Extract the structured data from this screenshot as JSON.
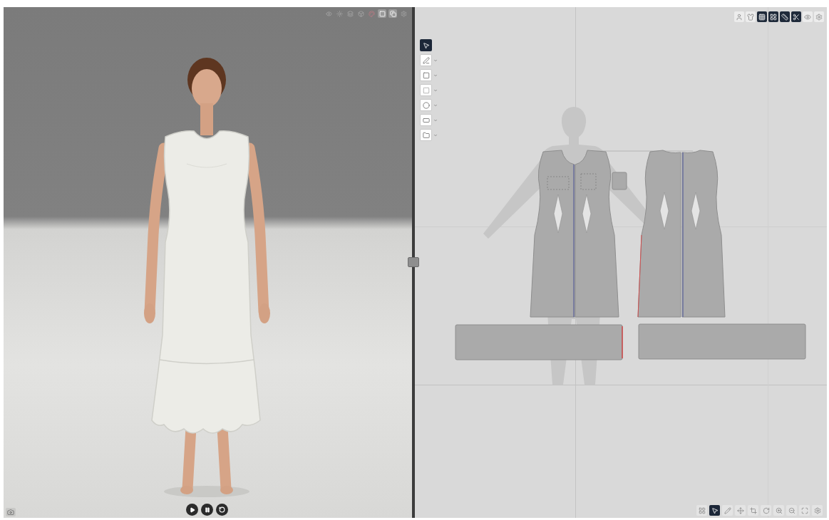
{
  "viewport_3d": {
    "toolbar": [
      {
        "on": false
      },
      {
        "on": false
      },
      {
        "on": false
      },
      {
        "on": false
      },
      {
        "on": false
      },
      {
        "on": true
      },
      {
        "on": true
      },
      {
        "on": false
      }
    ]
  },
  "pattern_view": {
    "toolbar": [
      {
        "selected": false
      },
      {
        "selected": false
      },
      {
        "selected": true
      },
      {
        "selected": true
      },
      {
        "selected": true
      },
      {
        "selected": true
      },
      {
        "selected": false
      },
      {
        "selected": false
      }
    ],
    "tools": [
      {
        "selected": true,
        "has_menu": false
      },
      {
        "selected": false,
        "has_menu": true
      },
      {
        "selected": false,
        "has_menu": true
      },
      {
        "selected": false,
        "has_menu": true
      },
      {
        "selected": false,
        "has_menu": true
      },
      {
        "selected": false,
        "has_menu": true
      },
      {
        "selected": false,
        "has_menu": true
      }
    ],
    "bottom_toolbar": [
      {
        "selected": false
      },
      {
        "selected": true
      },
      {
        "selected": false
      },
      {
        "selected": false
      },
      {
        "selected": false
      },
      {
        "selected": false
      },
      {
        "selected": false
      },
      {
        "selected": false
      },
      {
        "selected": false
      },
      {
        "selected": false
      }
    ]
  }
}
